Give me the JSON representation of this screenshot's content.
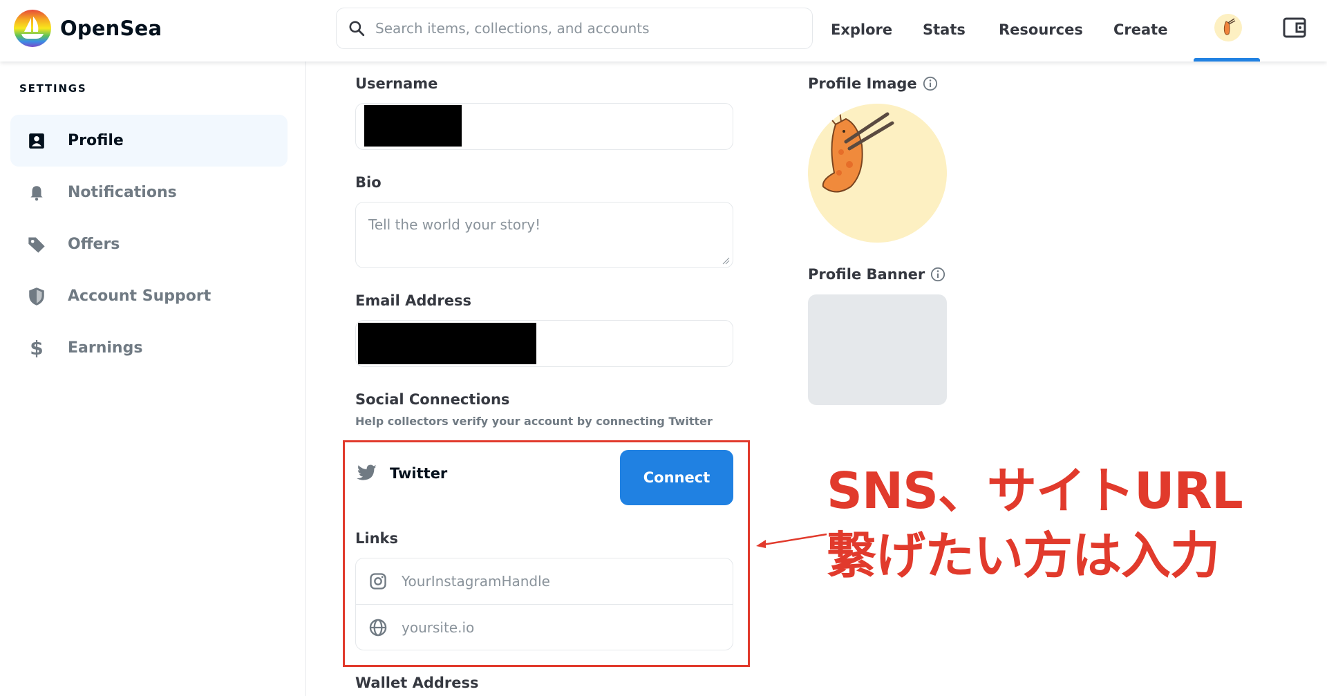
{
  "header": {
    "brand": "OpenSea",
    "search_placeholder": "Search items, collections, and accounts",
    "nav": [
      "Explore",
      "Stats",
      "Resources",
      "Create"
    ],
    "accent": "#2081e2"
  },
  "sidebar": {
    "heading": "SETTINGS",
    "items": [
      {
        "label": "Profile",
        "icon": "profile-icon",
        "active": true
      },
      {
        "label": "Notifications",
        "icon": "bell-icon"
      },
      {
        "label": "Offers",
        "icon": "tag-icon"
      },
      {
        "label": "Account Support",
        "icon": "shield-icon"
      },
      {
        "label": "Earnings",
        "icon": "dollar-icon"
      }
    ]
  },
  "form": {
    "username_label": "Username",
    "bio_label": "Bio",
    "bio_placeholder": "Tell the world your story!",
    "email_label": "Email Address",
    "social_label": "Social Connections",
    "social_helper": "Help collectors verify your account by connecting Twitter",
    "twitter_label": "Twitter",
    "connect_label": "Connect",
    "links_label": "Links",
    "instagram_placeholder": "YourInstagramHandle",
    "site_placeholder": "yoursite.io",
    "wallet_label": "Wallet Address"
  },
  "right": {
    "profile_image_label": "Profile Image",
    "profile_banner_label": "Profile Banner"
  },
  "annotation": {
    "line1": "SNS、サイトURL",
    "line2": "繋げたい方は入力",
    "color": "#e13a2c"
  }
}
